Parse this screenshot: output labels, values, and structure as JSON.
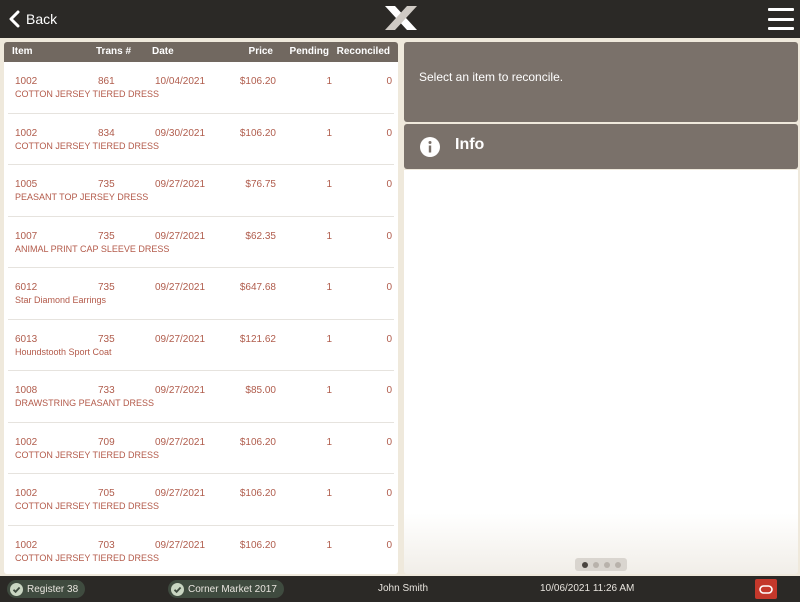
{
  "header": {
    "back_label": "Back",
    "logo_icon": "x-logo-icon",
    "menu_icon": "hamburger-menu-icon"
  },
  "table": {
    "columns": {
      "item": "Item",
      "trans": "Trans #",
      "date": "Date",
      "price": "Price",
      "pending": "Pending",
      "reconciled": "Reconciled"
    },
    "rows": [
      {
        "item": "1002",
        "trans": "861",
        "date": "10/04/2021",
        "price": "$106.20",
        "pending": "1",
        "reconciled": "0",
        "desc": "COTTON JERSEY TIERED DRESS"
      },
      {
        "item": "1002",
        "trans": "834",
        "date": "09/30/2021",
        "price": "$106.20",
        "pending": "1",
        "reconciled": "0",
        "desc": "COTTON JERSEY TIERED DRESS"
      },
      {
        "item": "1005",
        "trans": "735",
        "date": "09/27/2021",
        "price": "$76.75",
        "pending": "1",
        "reconciled": "0",
        "desc": "PEASANT TOP JERSEY DRESS"
      },
      {
        "item": "1007",
        "trans": "735",
        "date": "09/27/2021",
        "price": "$62.35",
        "pending": "1",
        "reconciled": "0",
        "desc": "ANIMAL PRINT CAP SLEEVE DRESS"
      },
      {
        "item": "6012",
        "trans": "735",
        "date": "09/27/2021",
        "price": "$647.68",
        "pending": "1",
        "reconciled": "0",
        "desc": "Star Diamond Earrings"
      },
      {
        "item": "6013",
        "trans": "735",
        "date": "09/27/2021",
        "price": "$121.62",
        "pending": "1",
        "reconciled": "0",
        "desc": "Houndstooth Sport Coat"
      },
      {
        "item": "1008",
        "trans": "733",
        "date": "09/27/2021",
        "price": "$85.00",
        "pending": "1",
        "reconciled": "0",
        "desc": "DRAWSTRING PEASANT DRESS"
      },
      {
        "item": "1002",
        "trans": "709",
        "date": "09/27/2021",
        "price": "$106.20",
        "pending": "1",
        "reconciled": "0",
        "desc": "COTTON JERSEY TIERED DRESS"
      },
      {
        "item": "1002",
        "trans": "705",
        "date": "09/27/2021",
        "price": "$106.20",
        "pending": "1",
        "reconciled": "0",
        "desc": "COTTON JERSEY TIERED DRESS"
      },
      {
        "item": "1002",
        "trans": "703",
        "date": "09/27/2021",
        "price": "$106.20",
        "pending": "1",
        "reconciled": "0",
        "desc": "COTTON JERSEY TIERED DRESS"
      }
    ]
  },
  "detail": {
    "message": "Select an item to reconcile.",
    "info_label": "Info",
    "info_icon": "info-circle-icon"
  },
  "pager": {
    "pages": 4,
    "active": 1
  },
  "status": {
    "register": "Register 38",
    "store": "Corner Market 2017",
    "user": "John Smith",
    "datetime": "10/06/2021 11:26 AM",
    "oracle_icon": "oracle-logo-icon"
  },
  "colors": {
    "bar": "#2b2926",
    "panel": "#7a716a",
    "header_row": "#716860",
    "row_text": "#b35a4a",
    "oracle_red": "#c4382b"
  }
}
